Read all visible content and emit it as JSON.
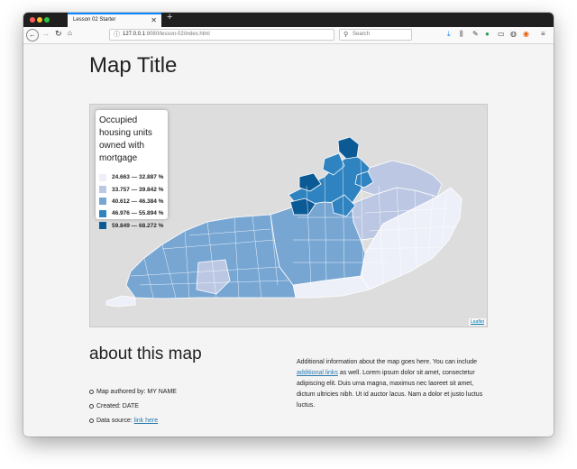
{
  "browser": {
    "tab_title": "Lesson 02 Starter",
    "tab_close": "✕",
    "new_tab": "+",
    "url_host": "127.0.0.1",
    "url_path": ":8080/lesson-02/index.html",
    "search_placeholder": "Search",
    "icons": [
      "back-icon",
      "forward-icon",
      "reload-icon",
      "home-icon",
      "download-icon",
      "library-icon",
      "sync-icon",
      "extension-icon",
      "sidebar-icon",
      "account-icon",
      "firefox-icon",
      "menu-icon"
    ]
  },
  "page": {
    "title": "Map Title",
    "legend": {
      "title": "Occupied housing units owned with mortgage",
      "items": [
        {
          "label": "24.663 — 32.887 %",
          "color": "#eef0f9"
        },
        {
          "label": "33.757 — 39.842 %",
          "color": "#bcc8e3"
        },
        {
          "label": "40.612 — 46.384 %",
          "color": "#77a6d3"
        },
        {
          "label": "46.976 — 55.894 %",
          "color": "#2f83c0"
        },
        {
          "label": "59.849 — 68.272 %",
          "color": "#0b5a96"
        }
      ]
    },
    "attribution": "Leaflet",
    "about_title": "about this map",
    "about_items": {
      "author": "Map authored by: MY NAME",
      "created": "Created: DATE",
      "source_prefix": "Data source: ",
      "source_link": "link here"
    },
    "about_text": {
      "part1": "Additional information about the map goes here. You can include ",
      "link": "additional links",
      "part2": " as well. Lorem ipsum dolor sit amet, consectetur adipiscing elit. Duis urna magna, maximus nec laoreet sit amet, dictum ultricies nibh. Ut id auctor lacus. Nam a dolor et justo luctus luctus."
    }
  }
}
